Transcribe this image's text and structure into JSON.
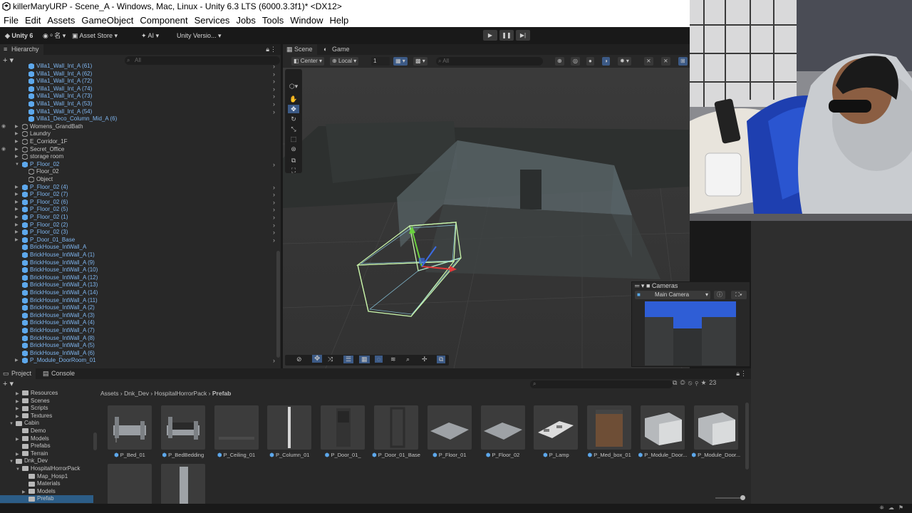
{
  "window": {
    "title": "killerMaryURP - Scene_A - Windows, Mac, Linux - Unity 6.3 LTS (6000.3.3f1)* <DX12>"
  },
  "menu": [
    "File",
    "Edit",
    "Assets",
    "GameObject",
    "Component",
    "Services",
    "Jobs",
    "Tools",
    "Window",
    "Help"
  ],
  "toolbar": {
    "unity_label": "Unity 6",
    "account_label": "ᵒ 名",
    "asset_store": "Asset Store",
    "ai": "AI",
    "version_control": "Unity Versio..."
  },
  "hierarchy": {
    "tab": "Hierarchy",
    "search_placeholder": "All",
    "rows": [
      {
        "label": "Villa1_Wall_Int_A (61)",
        "indent": 2,
        "prefab": true,
        "more": true
      },
      {
        "label": "Villa1_Wall_Int_A (62)",
        "indent": 2,
        "prefab": true,
        "more": true
      },
      {
        "label": "Villa1_Wall_Int_A (72)",
        "indent": 2,
        "prefab": true,
        "more": true
      },
      {
        "label": "Villa1_Wall_Int_A (74)",
        "indent": 2,
        "prefab": true,
        "more": true
      },
      {
        "label": "Villa1_Wall_Int_A (73)",
        "indent": 2,
        "prefab": true,
        "more": true
      },
      {
        "label": "Villa1_Wall_Int_A (53)",
        "indent": 2,
        "prefab": true,
        "more": true
      },
      {
        "label": "Villa1_Wall_Int_A (54)",
        "indent": 2,
        "prefab": true,
        "more": true
      },
      {
        "label": "Villa1_Deco_Column_Mid_A (6)",
        "indent": 2,
        "prefab": true,
        "more": false
      },
      {
        "label": "Womens_GrandBath",
        "indent": 1,
        "prefab": false,
        "arrow": true,
        "eye": true
      },
      {
        "label": "Laundry",
        "indent": 1,
        "prefab": false,
        "arrow": true
      },
      {
        "label": "E_Corridor_1F",
        "indent": 1,
        "prefab": false,
        "arrow": true
      },
      {
        "label": "Secret_Office",
        "indent": 1,
        "prefab": false,
        "arrow": true,
        "eye": true
      },
      {
        "label": "storage room",
        "indent": 1,
        "prefab": false,
        "arrow": true
      },
      {
        "label": "P_Floor_02",
        "indent": 1,
        "prefab": true,
        "arrow": true,
        "open": true,
        "more": true
      },
      {
        "label": "Floor_02",
        "indent": 2,
        "prefab": false
      },
      {
        "label": "Object",
        "indent": 2,
        "prefab": false
      },
      {
        "label": "P_Floor_02 (4)",
        "indent": 1,
        "prefab": true,
        "arrow": true,
        "more": true
      },
      {
        "label": "P_Floor_02 (7)",
        "indent": 1,
        "prefab": true,
        "arrow": true,
        "more": true
      },
      {
        "label": "P_Floor_02 (6)",
        "indent": 1,
        "prefab": true,
        "arrow": true,
        "more": true
      },
      {
        "label": "P_Floor_02 (5)",
        "indent": 1,
        "prefab": true,
        "arrow": true,
        "more": true
      },
      {
        "label": "P_Floor_02 (1)",
        "indent": 1,
        "prefab": true,
        "arrow": true,
        "more": true
      },
      {
        "label": "P_Floor_02 (2)",
        "indent": 1,
        "prefab": true,
        "arrow": true,
        "more": true
      },
      {
        "label": "P_Floor_02 (3)",
        "indent": 1,
        "prefab": true,
        "arrow": true,
        "more": true
      },
      {
        "label": "P_Door_01_Base",
        "indent": 1,
        "prefab": true,
        "arrow": true,
        "more": true
      },
      {
        "label": "BrickHouse_IntWall_A",
        "indent": 1,
        "prefab": true
      },
      {
        "label": "BrickHouse_IntWall_A (1)",
        "indent": 1,
        "prefab": true
      },
      {
        "label": "BrickHouse_IntWall_A (9)",
        "indent": 1,
        "prefab": true
      },
      {
        "label": "BrickHouse_IntWall_A (10)",
        "indent": 1,
        "prefab": true
      },
      {
        "label": "BrickHouse_IntWall_A (12)",
        "indent": 1,
        "prefab": true
      },
      {
        "label": "BrickHouse_IntWall_A (13)",
        "indent": 1,
        "prefab": true
      },
      {
        "label": "BrickHouse_IntWall_A (14)",
        "indent": 1,
        "prefab": true
      },
      {
        "label": "BrickHouse_IntWall_A (11)",
        "indent": 1,
        "prefab": true
      },
      {
        "label": "BrickHouse_IntWall_A (2)",
        "indent": 1,
        "prefab": true
      },
      {
        "label": "BrickHouse_IntWall_A (3)",
        "indent": 1,
        "prefab": true
      },
      {
        "label": "BrickHouse_IntWall_A (4)",
        "indent": 1,
        "prefab": true
      },
      {
        "label": "BrickHouse_IntWall_A (7)",
        "indent": 1,
        "prefab": true
      },
      {
        "label": "BrickHouse_IntWall_A (8)",
        "indent": 1,
        "prefab": true
      },
      {
        "label": "BrickHouse_IntWall_A (5)",
        "indent": 1,
        "prefab": true
      },
      {
        "label": "BrickHouse_IntWall_A (6)",
        "indent": 1,
        "prefab": true
      },
      {
        "label": "P_Module_DoorRoom_01",
        "indent": 1,
        "prefab": true,
        "arrow": true,
        "more": true
      }
    ]
  },
  "scene": {
    "tabs": [
      "Scene",
      "Game"
    ],
    "pivot": "Center",
    "space": "Local",
    "snap_value": "1",
    "search_placeholder": "All"
  },
  "cameras_overlay": {
    "title": "Cameras",
    "selected_camera": "Main Camera"
  },
  "project": {
    "tabs": [
      "Project",
      "Console"
    ],
    "count": "23",
    "breadcrumb": [
      "Assets",
      "Dnk_Dev",
      "HospitalHorrorPack",
      "Prefab"
    ],
    "tree": [
      {
        "label": "Resources",
        "indent": 2,
        "arrow": true
      },
      {
        "label": "Scenes",
        "indent": 2,
        "arrow": true
      },
      {
        "label": "Scripts",
        "indent": 2,
        "arrow": true
      },
      {
        "label": "Textures",
        "indent": 2,
        "arrow": true
      },
      {
        "label": "Cabin",
        "indent": 1,
        "arrow": true,
        "open": true
      },
      {
        "label": "Demo",
        "indent": 2
      },
      {
        "label": "Models",
        "indent": 2,
        "arrow": true
      },
      {
        "label": "Prefabs",
        "indent": 2
      },
      {
        "label": "Terrain",
        "indent": 2,
        "arrow": true
      },
      {
        "label": "Dnk_Dev",
        "indent": 1,
        "arrow": true,
        "open": true
      },
      {
        "label": "HospitalHorrorPack",
        "indent": 2,
        "arrow": true,
        "open": true
      },
      {
        "label": "Map_Hosp1",
        "indent": 3
      },
      {
        "label": "Materials",
        "indent": 3
      },
      {
        "label": "Models",
        "indent": 3,
        "arrow": true
      },
      {
        "label": "Prefab",
        "indent": 3,
        "selected": true
      }
    ],
    "assets": [
      {
        "label": "P_Bed_01",
        "kind": "bed"
      },
      {
        "label": "P_BedBedding",
        "kind": "bedding"
      },
      {
        "label": "P_Ceiling_01",
        "kind": "ceiling"
      },
      {
        "label": "P_Column_01",
        "kind": "column"
      },
      {
        "label": "P_Door_01_",
        "kind": "door"
      },
      {
        "label": "P_Door_01_Base",
        "kind": "doorframe"
      },
      {
        "label": "P_Floor_01",
        "kind": "floor"
      },
      {
        "label": "P_Floor_02",
        "kind": "floor"
      },
      {
        "label": "P_Lamp",
        "kind": "lamp"
      },
      {
        "label": "P_Med_box_01",
        "kind": "medbox"
      },
      {
        "label": "P_Module_Door...",
        "kind": "room"
      },
      {
        "label": "P_Module_Door...",
        "kind": "room"
      },
      {
        "label": "",
        "kind": "blank"
      },
      {
        "label": "",
        "kind": "wall"
      }
    ]
  }
}
